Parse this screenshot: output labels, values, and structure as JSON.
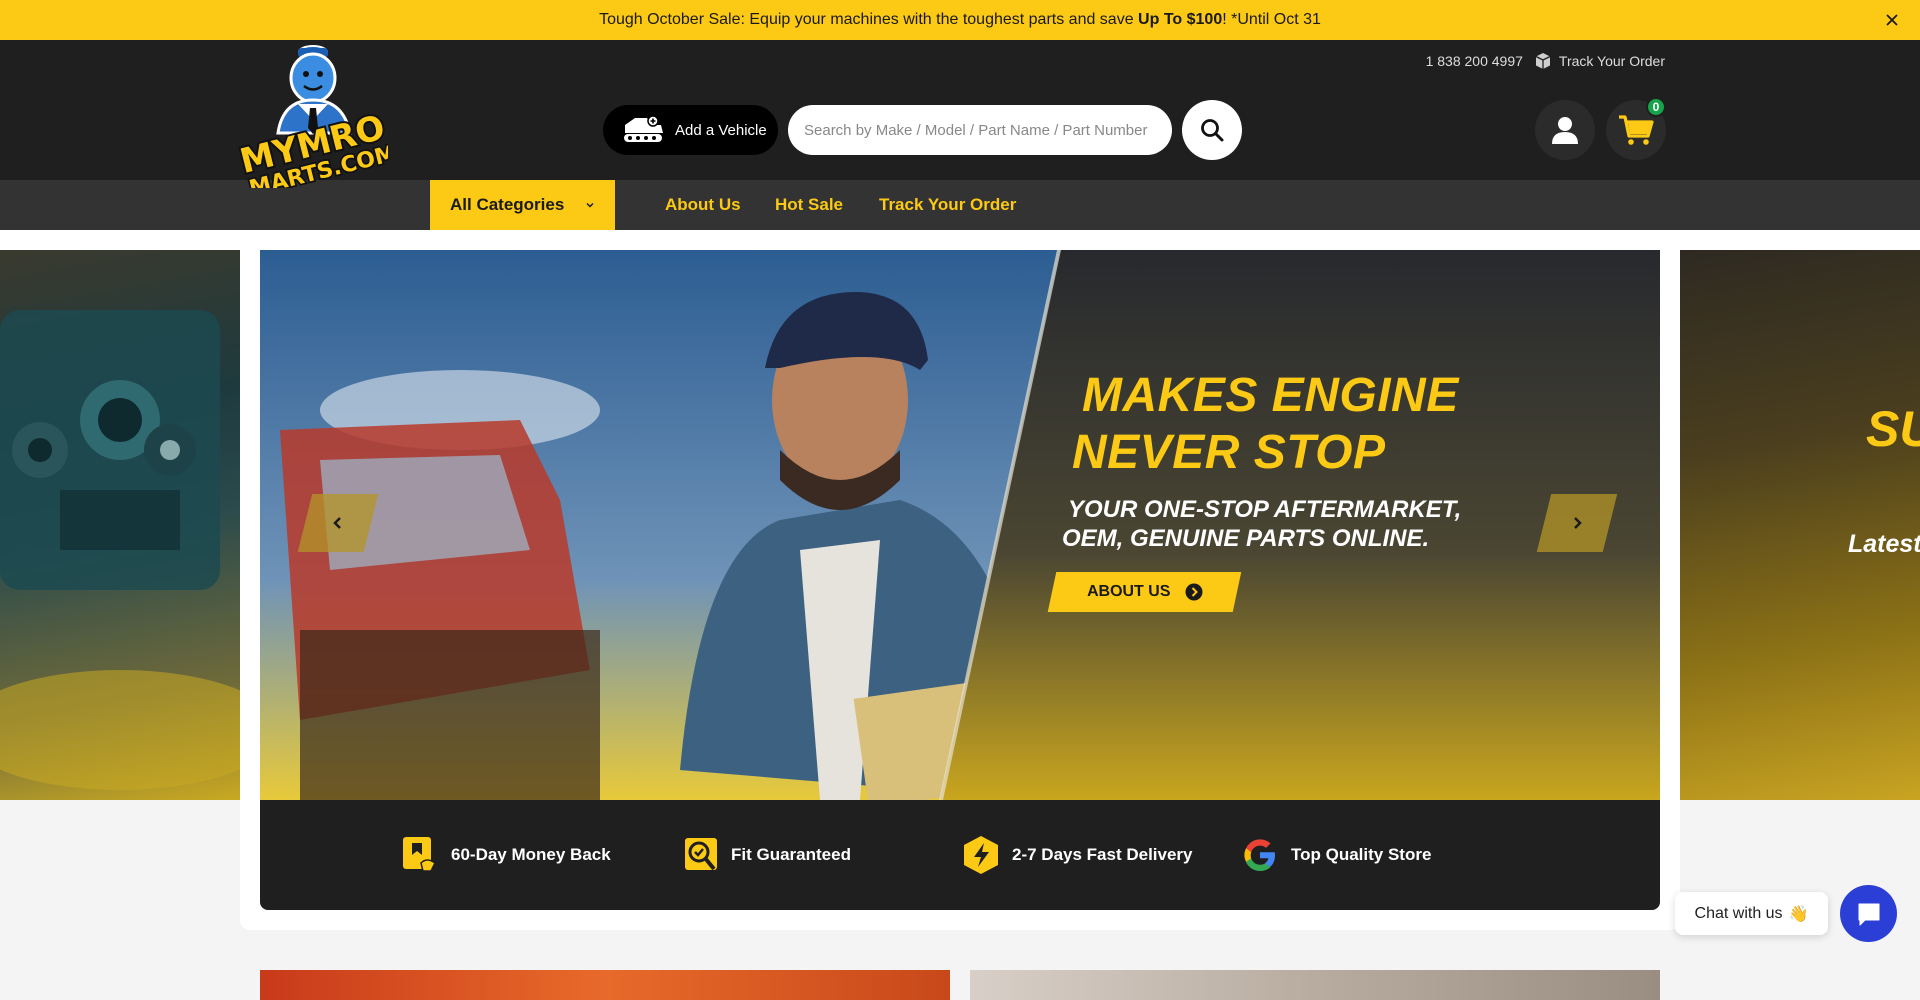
{
  "announcement": {
    "text_before": "Tough October Sale: Equip your machines with the toughest parts and save ",
    "text_bold": "Up To $100",
    "text_after": "! *Until Oct 31"
  },
  "topbar": {
    "phone": "1 838 200 4997",
    "track_order": "Track Your Order"
  },
  "header": {
    "logo_text_line1": "MYMRO",
    "logo_text_line2": "MARTS.COM",
    "add_vehicle": "Add a Vehicle",
    "search_placeholder": "Search by Make / Model / Part Name / Part Number",
    "cart_count": "0"
  },
  "nav": {
    "all_categories": "All Categories",
    "links": [
      "About Us",
      "Hot Sale",
      "Track Your Order"
    ]
  },
  "hero": {
    "title_line1": "MAKES ENGINE",
    "title_line2": "NEVER STOP",
    "subtitle_line1": "YOUR ONE-STOP AFTERMARKET,",
    "subtitle_line2": "OEM, GENUINE PARTS ONLINE.",
    "cta": "ABOUT US",
    "next_slide_partial_title": "SU",
    "next_slide_partial_sub": "Latest"
  },
  "features": [
    {
      "label": "60-Day Money Back",
      "icon": "money-back-icon"
    },
    {
      "label": "Fit Guaranteed",
      "icon": "fit-check-icon"
    },
    {
      "label": "2-7 Days Fast Delivery",
      "icon": "lightning-icon"
    },
    {
      "label": "Top Quality Store",
      "icon": "google-icon"
    }
  ],
  "chat": {
    "label": "Chat with us",
    "emoji": "👋"
  },
  "colors": {
    "brand_yellow": "#fcc915",
    "header_dark": "#1f1f1f",
    "nav_dark": "#333333",
    "chat_blue": "#2b3fd6",
    "badge_green": "#17a34a"
  }
}
